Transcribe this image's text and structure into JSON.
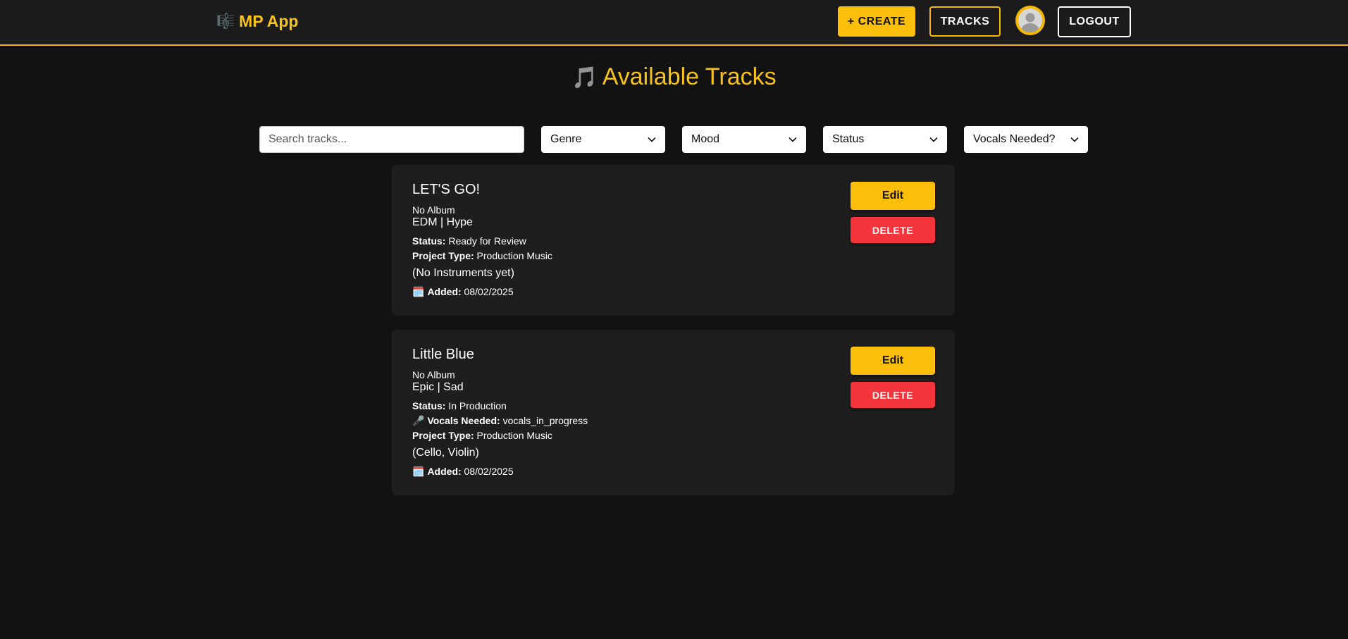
{
  "header": {
    "brand_icon": "🎼",
    "brand": "MP App",
    "create_label": "+ CREATE",
    "tracks_label": "TRACKS",
    "logout_label": "LOGOUT",
    "accent_color": "#f5b800"
  },
  "page": {
    "title_icon": "🎵",
    "title": "Available Tracks"
  },
  "filters": {
    "search_placeholder": "Search tracks...",
    "genre": "Genre",
    "mood": "Mood",
    "status": "Status",
    "vocals": "Vocals Needed?"
  },
  "tracks": [
    {
      "title": "LET'S GO!",
      "album": "No Album",
      "genre_mood": "EDM | Hype",
      "status_label": "Status:",
      "status": "Ready for Review",
      "project_type_label": "Project Type:",
      "project_type": "Production Music",
      "instruments": "(No Instruments yet)",
      "added_icon": "🗓️",
      "added_label": "Added:",
      "added": "08/02/2025",
      "edit_label": "Edit",
      "delete_label": "DELETE"
    },
    {
      "title": "Little Blue",
      "album": "No Album",
      "genre_mood": "Epic | Sad",
      "status_label": "Status:",
      "status": "In Production",
      "vocals_icon": "🎤",
      "vocals_label": "Vocals Needed:",
      "vocals": "vocals_in_progress",
      "project_type_label": "Project Type:",
      "project_type": "Production Music",
      "instruments": "(Cello, Violin)",
      "added_icon": "🗓️",
      "added_label": "Added:",
      "added": "08/02/2025",
      "edit_label": "Edit",
      "delete_label": "DELETE"
    }
  ],
  "colors": {
    "background": "#121212",
    "card": "#1e1e1e",
    "primary": "#fbbf0b",
    "danger": "#f4353c"
  }
}
